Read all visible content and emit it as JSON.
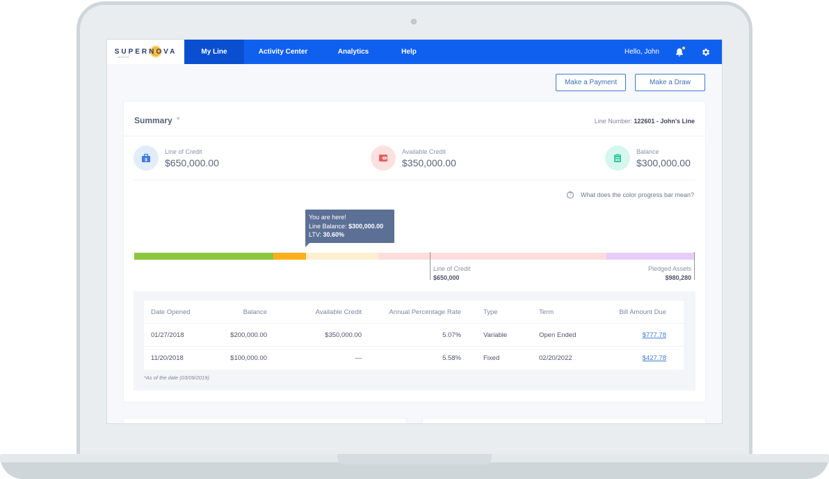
{
  "brand": {
    "name": "SUPERNOVA",
    "subtitle": "LENDING"
  },
  "nav": {
    "items": [
      {
        "label": "My Line",
        "active": true
      },
      {
        "label": "Activity Center",
        "active": false
      },
      {
        "label": "Analytics",
        "active": false
      },
      {
        "label": "Help",
        "active": false
      }
    ],
    "greeting": "Hello, John",
    "icons": {
      "notifications": "bell-icon",
      "settings": "gear-icon"
    },
    "accent_color": "#1060f0"
  },
  "actions": {
    "make_payment": "Make a Payment",
    "make_draw": "Make a Draw"
  },
  "summary": {
    "title": "Summary",
    "line_number_label": "Line Number:",
    "line_number_value": "122601 - John's Line",
    "stats": [
      {
        "label": "Line of Credit",
        "value": "$650,000.00",
        "icon": "briefcase-dollar-icon",
        "color": "#3d7be0",
        "bg": "#e3ecfb"
      },
      {
        "label": "Available Credit",
        "value": "$350,000.00",
        "icon": "wallet-icon",
        "color": "#e4605a",
        "bg": "#fde1e0"
      },
      {
        "label": "Balance",
        "value": "$300,000.00",
        "icon": "clipboard-icon",
        "color": "#34c79e",
        "bg": "#d6f7ee"
      }
    ],
    "help_link": "What does the color progress bar mean?"
  },
  "progress": {
    "tooltip": {
      "line1": "You are here!",
      "balance_label": "Line Balance:",
      "balance_value": "$300,000.00",
      "ltv_label": "LTV:",
      "ltv_value": "30.60%"
    },
    "segments": [
      {
        "name": "green",
        "color": "#8cc63e",
        "fraction": 0.248
      },
      {
        "name": "orange",
        "color": "#fdae1a",
        "fraction": 0.058
      },
      {
        "name": "light-yellow",
        "color": "#fdefd0",
        "fraction": 0.129
      },
      {
        "name": "light-pink",
        "color": "#fcdcdc",
        "fraction": 0.407
      },
      {
        "name": "lavender",
        "color": "#e5cdf8",
        "fraction": 0.158
      }
    ],
    "markers": [
      {
        "label": "Line of Credit",
        "value": "$650,000"
      },
      {
        "label": "Pledged Assets",
        "value": "$980,280"
      }
    ]
  },
  "table": {
    "columns": [
      "Date Opened",
      "Balance",
      "Available Credit",
      "Annual Percentage Rate",
      "Type",
      "Term",
      "Bill Amount Due"
    ],
    "rows": [
      [
        "01/27/2018",
        "$200,000.00",
        "$350,000.00",
        "5.07%",
        "Variable",
        "Open Ended",
        "$777.78"
      ],
      [
        "11/20/2018",
        "$100,000.00",
        "—",
        "5.58%",
        "Fixed",
        "02/20/2022",
        "$427.78"
      ]
    ],
    "footnote": "*As of the date (03/09/2019)"
  }
}
